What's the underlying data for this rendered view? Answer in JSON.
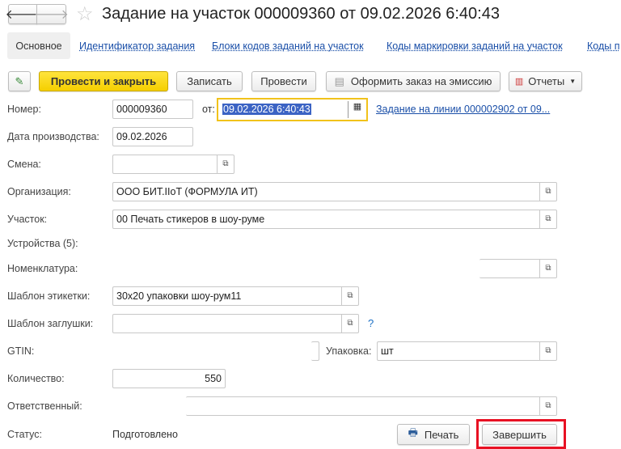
{
  "title": "Задание на участок 000009360 от 09.02.2026 6:40:43",
  "tabs": [
    "Основное",
    "Идентификатор задания",
    "Блоки кодов заданий на участок",
    "Коды маркировки заданий на участок",
    "Коды п"
  ],
  "toolbar": {
    "post_close": "Провести и закрыть",
    "save": "Записать",
    "post": "Провести",
    "emission": "Оформить заказ на эмиссию",
    "reports": "Отчеты"
  },
  "form": {
    "number_label": "Номер:",
    "number": "000009360",
    "from_label": "от:",
    "date": "09.02.2026  6:40:43",
    "line_link": "Задание на линии 000002902 от 09...",
    "prod_date_label": "Дата производства:",
    "prod_date": "09.02.2026",
    "shift_label": "Смена:",
    "shift": "",
    "org_label": "Организация:",
    "org": "ООО БИТ.IIoT (ФОРМУЛА ИТ)",
    "site_label": "Участок:",
    "site": "00 Печать стикеров в шоу-руме",
    "devices_label": "Устройства (5):",
    "nomenclature_label": "Номенклатура:",
    "nomenclature": "",
    "label_template_label": "Шаблон этикетки:",
    "label_template": "30x20 упаковки шоу-рум11",
    "stub_template_label": "Шаблон заглушки:",
    "stub_template": "",
    "help": "?",
    "gtin_label": "GTIN:",
    "gtin": "",
    "package_label": "Упаковка:",
    "package": "шт",
    "qty_label": "Количество:",
    "qty": "550",
    "responsible_label": "Ответственный:",
    "responsible": "",
    "status_label": "Статус:",
    "status": "Подготовлено"
  },
  "footer": {
    "print": "Печать",
    "finish": "Завершить"
  },
  "colors": {
    "accent_yellow": "#f5cf00",
    "highlight": "#e81123",
    "link": "#1a4fa8"
  }
}
